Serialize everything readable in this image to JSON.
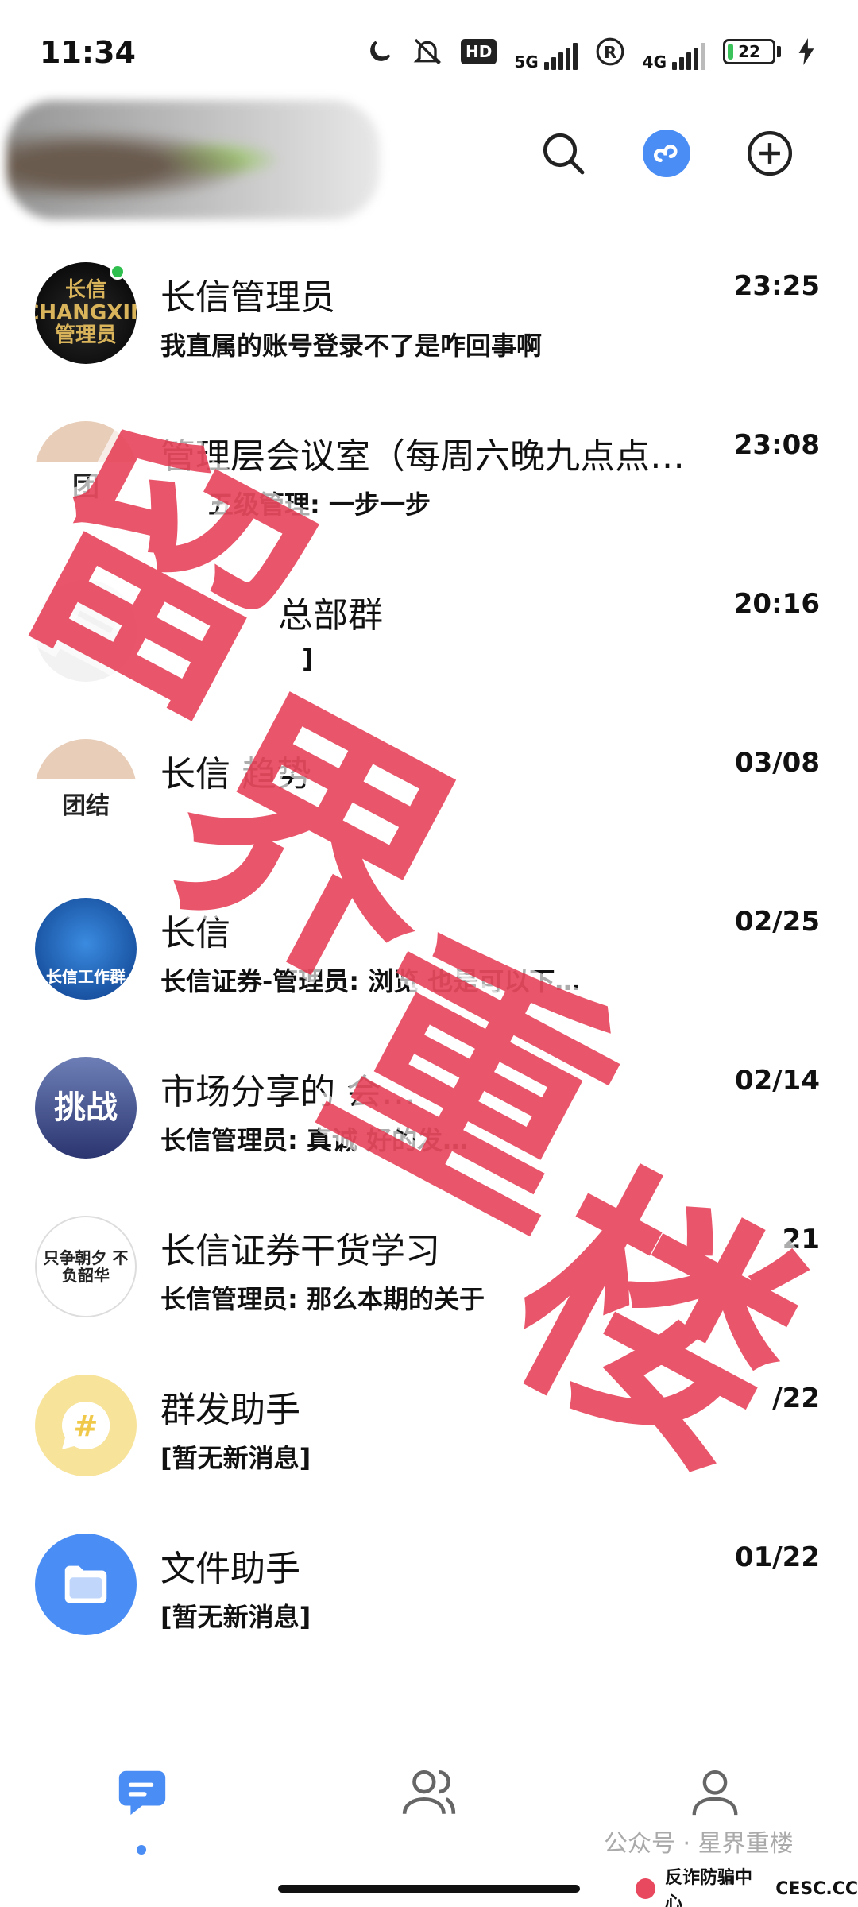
{
  "status_bar": {
    "time": "11:34",
    "signal_1_label": "5G",
    "signal_2_label": "4G",
    "hd_label": "HD",
    "roaming_label": "R",
    "battery_level": 22,
    "battery_text": "22"
  },
  "header": {
    "profile_label": "",
    "search_icon": "search-icon",
    "link_icon": "mini-program-icon",
    "add_icon": "plus-circle-icon"
  },
  "chats": [
    {
      "title": "长信管理员",
      "time": "23:25",
      "preview": "我直属的账号登录不了是咋回事啊",
      "avatar_text": "长信CHANGXIN 管理员",
      "online": true
    },
    {
      "title": "管理层会议室（每周六晚九点点…",
      "time": "23:08",
      "preview": "五级管理: 一步一步",
      "avatar_text": "团"
    },
    {
      "title": "总部群",
      "time": "20:16",
      "preview": "]",
      "avatar_text": ""
    },
    {
      "title": "长信 趋势",
      "time": "03/08",
      "preview": "",
      "avatar_text": "团结"
    },
    {
      "title": "长信",
      "time": "02/25",
      "preview": "长信证券-管理员: 浏览 也是可以下…",
      "avatar_text": "长信工作群"
    },
    {
      "title": "市场分享的 会…",
      "time": "02/14",
      "preview": "长信管理员: 真诚 好的发…",
      "avatar_text": "挑战"
    },
    {
      "title": "长信证券干货学习",
      "time": "21",
      "preview": "长信管理员: 那么本期的关于",
      "avatar_text": "只争朝夕 不负韶华"
    },
    {
      "title": "群发助手",
      "time": "/22",
      "preview": "[暂无新消息]",
      "avatar_text": "#"
    },
    {
      "title": "文件助手",
      "time": "01/22",
      "preview": "[暂无新消息]",
      "avatar_text": ""
    }
  ],
  "watermark": {
    "chars": [
      "留",
      "界",
      "重",
      "楼"
    ]
  },
  "footer": {
    "public_account": "公众号 · 星界重楼",
    "center_name": "反诈防骗中心",
    "center_site": "CESC.CC"
  },
  "colors": {
    "accent": "#4a8df4",
    "stamp": "#e8495f",
    "online": "#2fbf4e"
  }
}
